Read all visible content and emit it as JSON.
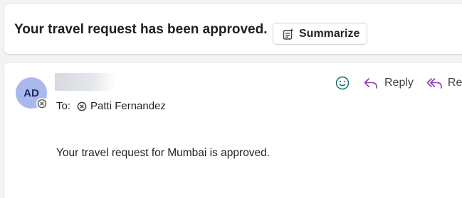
{
  "subject_bar": {
    "subject": "Your travel request has been approved.",
    "summarize_label": "Summarize",
    "summarize_icon": "summarize-icon"
  },
  "message": {
    "avatar_initials": "AD",
    "avatar_color": "#a9b9ee",
    "presence_icon": "presence-offline-icon",
    "to_label": "To:",
    "recipient": "Patti Fernandez",
    "recipient_icon": "presence-offline-icon",
    "actions": {
      "emoji_icon": "smiley-icon",
      "reply_label": "Reply",
      "reply_all_label": "Rep",
      "accent_color": "#8a3bb8"
    },
    "body": "Your travel request for Mumbai is approved."
  }
}
